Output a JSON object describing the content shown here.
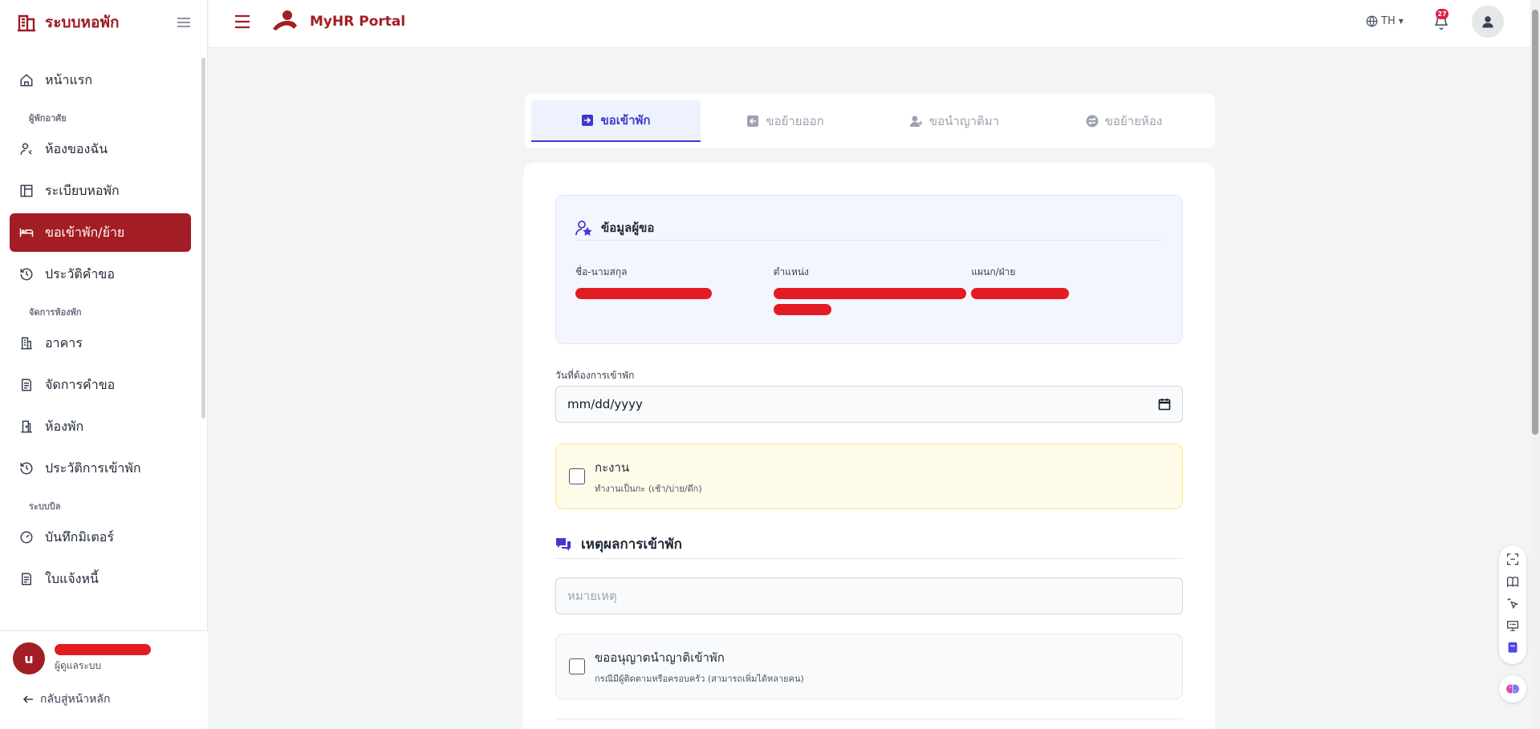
{
  "sidebar": {
    "brand_title": "ระบบหอพัก",
    "sections": {
      "residents": "ผู้พักอาศัย",
      "room_management": "จัดการห้องพัก",
      "billing": "ระบบบิล"
    },
    "items": {
      "home": "หน้าแรก",
      "my_room": "ห้องของฉัน",
      "dorm_rules": "ระเบียบหอพัก",
      "move_request": "ขอเข้าพัก/ย้าย",
      "request_history": "ประวัติคำขอ",
      "building": "อาคาร",
      "manage_requests": "จัดการคำขอ",
      "rooms": "ห้องพัก",
      "stay_history": "ประวัติการเข้าพัก",
      "meter_record": "บันทึกมิเตอร์",
      "invoice": "ใบแจ้งหนี้"
    },
    "active_item": "move_request",
    "user": {
      "initial": "u",
      "role": "ผู้ดูแลระบบ"
    },
    "back_link": "กลับสู่หน้าหลัก"
  },
  "header": {
    "portal_title": "MyHR Portal",
    "language": "TH",
    "notification_count": "27"
  },
  "tabs": [
    {
      "label": "ขอเข้าพัก",
      "icon": "login-icon",
      "active": true
    },
    {
      "label": "ขอย้ายออก",
      "icon": "logout-icon",
      "active": false
    },
    {
      "label": "ขอนำญาติมา",
      "icon": "user-plus-icon",
      "active": false
    },
    {
      "label": "ขอย้ายห้อง",
      "icon": "swap-icon",
      "active": false
    }
  ],
  "form": {
    "applicant_info_title": "ข้อมูลผู้ขอ",
    "name_label": "ชื่อ-นามสกุล",
    "position_label": "ตำแหน่ง",
    "department_label": "แผนก/ฝ่าย",
    "date_label": "วันที่ต้องการเข้าพัก",
    "date_placeholder": "mm/dd/yyyy",
    "shift_title": "กะงาน",
    "shift_subtitle": "ทำงานเป็นกะ (เช้า/บ่าย/ดึก)",
    "reason_title": "เหตุผลการเข้าพัก",
    "note_placeholder": "หมายเหตุ",
    "guest_title": "ขออนุญาตนำญาติเข้าพัก",
    "guest_subtitle": "กรณีมีผู้ติดตามหรือครอบครัว (สามารถเพิ่มได้หลายคน)"
  },
  "colors": {
    "brand": "#a31d24",
    "accent": "#4338ca",
    "redaction": "#e31b23"
  }
}
